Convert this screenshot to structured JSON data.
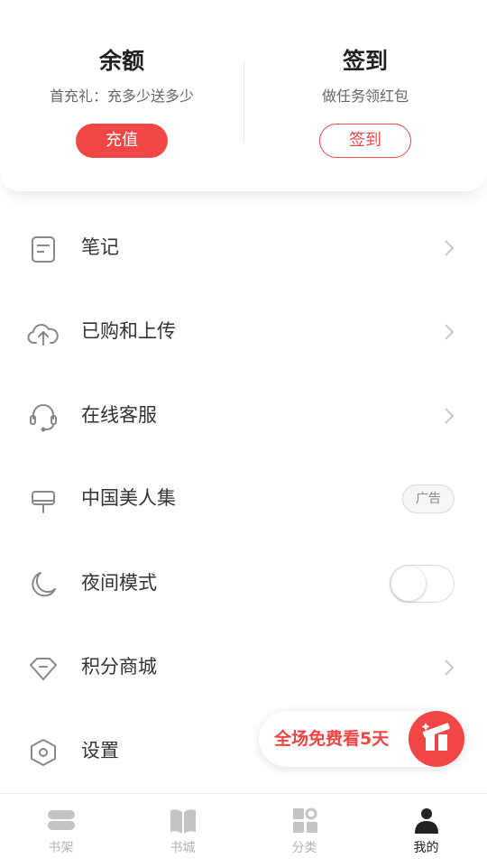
{
  "balance_card": {
    "title": "余额",
    "subtitle": "首充礼：充多少送多少",
    "button_label": "充值"
  },
  "checkin_card": {
    "title": "签到",
    "subtitle": "做任务领红包",
    "button_label": "签到"
  },
  "menu": {
    "items": [
      {
        "label": "笔记",
        "icon": "note-icon"
      },
      {
        "label": "已购和上传",
        "icon": "cloud-upload-icon"
      },
      {
        "label": "在线客服",
        "icon": "headset-icon"
      },
      {
        "label": "中国美人集",
        "icon": "sign-board-icon",
        "badge": "广告"
      },
      {
        "label": "夜间模式",
        "icon": "moon-icon",
        "toggle_on": false
      },
      {
        "label": "积分商城",
        "icon": "diamond-icon"
      },
      {
        "label": "设置",
        "icon": "settings-hexagon-icon"
      }
    ]
  },
  "promo": {
    "text": "全场免费看5天",
    "icon": "gift-icon"
  },
  "bottom_nav": {
    "items": [
      {
        "label": "书架",
        "icon": "bookshelf-icon",
        "active": false
      },
      {
        "label": "书城",
        "icon": "open-book-icon",
        "active": false
      },
      {
        "label": "分类",
        "icon": "category-grid-icon",
        "active": false
      },
      {
        "label": "我的",
        "icon": "profile-icon",
        "active": true
      }
    ]
  },
  "colors": {
    "accent": "#f04646",
    "text_primary": "#333333",
    "text_secondary": "#666666",
    "nav_inactive": "#b3b3b3",
    "nav_active": "#222222"
  }
}
